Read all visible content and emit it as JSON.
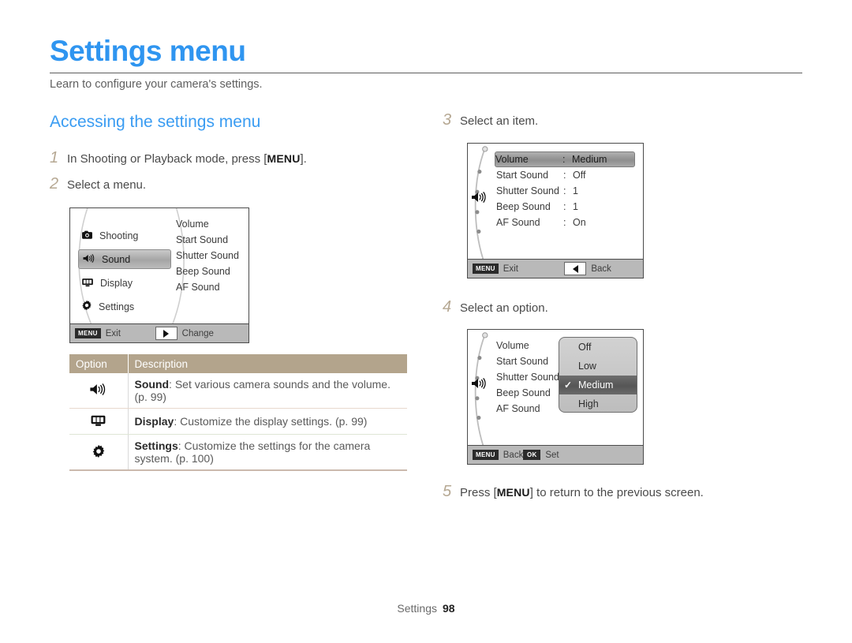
{
  "page": {
    "title": "Settings menu",
    "subtitle": "Learn to configure your camera's settings.",
    "section_heading": "Accessing the settings menu",
    "accent_color": "#2f95f0",
    "step_number_color": "#b6a893",
    "table_header_color": "#b3a48c"
  },
  "steps": {
    "s1": {
      "num": "1",
      "pre": "In Shooting or Playback mode, press [",
      "kbd": "MENU",
      "post": "]."
    },
    "s2": {
      "num": "2",
      "text": "Select a menu."
    },
    "s3": {
      "num": "3",
      "text": "Select an item."
    },
    "s4": {
      "num": "4",
      "text": "Select an option."
    },
    "s5": {
      "num": "5",
      "pre": "Press [",
      "kbd": "MENU",
      "post": "] to return to the previous screen."
    }
  },
  "screen_menu": {
    "categories": [
      {
        "label": "Shooting",
        "icon": "camera-icon",
        "selected": false
      },
      {
        "label": "Sound",
        "icon": "speaker-icon",
        "selected": true
      },
      {
        "label": "Display",
        "icon": "display-icon",
        "selected": false
      },
      {
        "label": "Settings",
        "icon": "gear-icon",
        "selected": false
      }
    ],
    "sub_items": [
      "Volume",
      "Start Sound",
      "Shutter Sound",
      "Beep Sound",
      "AF Sound"
    ],
    "bottom": {
      "left_badge": "MENU",
      "left_label": "Exit",
      "right_icon": "arrow-right-icon",
      "right_label": "Change"
    }
  },
  "screen_items": {
    "icon": "speaker-icon",
    "rows": [
      {
        "label": "Volume",
        "colon": ":",
        "value": "Medium",
        "highlighted": true
      },
      {
        "label": "Start Sound",
        "colon": ":",
        "value": "Off",
        "highlighted": false
      },
      {
        "label": "Shutter Sound",
        "colon": ":",
        "value": "1",
        "highlighted": false
      },
      {
        "label": "Beep Sound",
        "colon": ":",
        "value": "1",
        "highlighted": false
      },
      {
        "label": "AF Sound",
        "colon": ":",
        "value": "On",
        "highlighted": false
      }
    ],
    "bottom": {
      "left_badge": "MENU",
      "left_label": "Exit",
      "right_icon": "arrow-left-icon",
      "right_label": "Back"
    }
  },
  "screen_options": {
    "icon": "speaker-icon",
    "rows": [
      {
        "label": "Volume"
      },
      {
        "label": "Start Sound"
      },
      {
        "label": "Shutter Sound"
      },
      {
        "label": "Beep Sound"
      },
      {
        "label": "AF Sound"
      }
    ],
    "popup": {
      "options": [
        {
          "label": "Off",
          "selected": false
        },
        {
          "label": "Low",
          "selected": false
        },
        {
          "label": "Medium",
          "selected": true
        },
        {
          "label": "High",
          "selected": false
        }
      ],
      "check_glyph": "✓"
    },
    "bottom": {
      "left_badge": "MENU",
      "left_label": "Back",
      "right_badge": "OK",
      "right_label": "Set"
    }
  },
  "option_table": {
    "headers": {
      "option": "Option",
      "description": "Description"
    },
    "rows": [
      {
        "icon": "speaker-icon",
        "name": "Sound",
        "desc": ": Set various camera sounds and the volume. (p. 99)"
      },
      {
        "icon": "display-icon",
        "name": "Display",
        "desc": ": Customize the display settings. (p. 99)"
      },
      {
        "icon": "gear-icon",
        "name": "Settings",
        "desc": ": Customize the settings for the camera system. (p. 100)"
      }
    ]
  },
  "footer": {
    "label": "Settings",
    "page_number": "98"
  }
}
